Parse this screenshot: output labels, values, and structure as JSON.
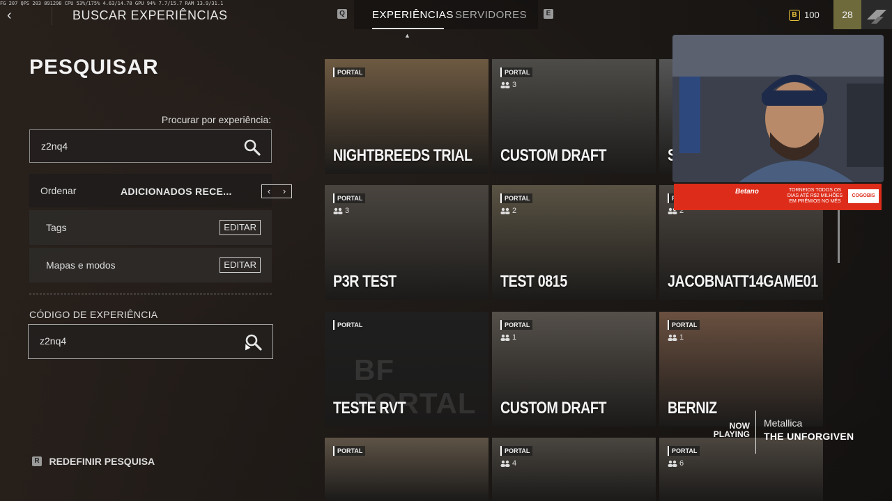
{
  "overlay": {
    "perf_stats": "FG 207 QPS 203 891298 CPU 53%/175% 4.63/14.78 GPU 94% 7.7/15.7 RAM 13.9/31.1"
  },
  "header": {
    "page_title": "BUSCAR EXPERIÊNCIAS",
    "key_left": "Q",
    "key_right": "E",
    "tabs": [
      {
        "label": "EXPERIÊNCIAS",
        "active": true
      },
      {
        "label": "SERVIDORES",
        "active": false
      }
    ],
    "currency": {
      "value": "100",
      "icon": "b-coin-icon"
    },
    "level": "28"
  },
  "left_panel": {
    "heading": "PESQUISAR",
    "search_label": "Procurar por experiência:",
    "search_value": "z2nq4",
    "sort": {
      "label": "Ordenar",
      "value": "ADICIONADOS RECE..."
    },
    "tags": {
      "label": "Tags",
      "button": "EDITAR"
    },
    "maps": {
      "label": "Mapas e modos",
      "button": "EDITAR"
    },
    "code_label": "CÓDIGO DE EXPERIÊNCIA",
    "code_value": "z2nq4",
    "reset": {
      "key": "R",
      "label": "REDEFINIR PESQUISA"
    }
  },
  "grid": {
    "cards": [
      {
        "badge": "PORTAL",
        "players": "",
        "title": "NIGHTBREEDS TRIAL",
        "bg": "#6e5a42"
      },
      {
        "badge": "PORTAL",
        "players": "3",
        "title": "CUSTOM DRAFT",
        "bg": "#4e4c48"
      },
      {
        "badge": "PORTAL",
        "players": "",
        "title": "S",
        "bg": "#555"
      },
      {
        "badge": "PORTAL",
        "players": "3",
        "title": "P3R TEST",
        "bg": "#4a453f"
      },
      {
        "badge": "PORTAL",
        "players": "2",
        "title": "TEST 0815",
        "bg": "#5a5344"
      },
      {
        "badge": "PORTAL",
        "players": "2",
        "title": "JACOBNATT14GAME01",
        "bg": "#4c4640"
      },
      {
        "badge": "PORTAL",
        "players": "",
        "title": "TESTE RVT",
        "bg": "#1f1f1f"
      },
      {
        "badge": "PORTAL",
        "players": "1",
        "title": "CUSTOM DRAFT",
        "bg": "#55504a"
      },
      {
        "badge": "PORTAL",
        "players": "1",
        "title": "BERNIZ",
        "bg": "#6a5040"
      },
      {
        "badge": "PORTAL",
        "players": "",
        "title": "",
        "bg": "#5e5346"
      },
      {
        "badge": "PORTAL",
        "players": "4",
        "title": "",
        "bg": "#4a4640"
      },
      {
        "badge": "PORTAL",
        "players": "6",
        "title": "",
        "bg": "#4c463f"
      }
    ],
    "watermark": "BF PORTAL"
  },
  "stream": {
    "banner_brand": "Betano",
    "banner_text": "TORNEIOS TODOS OS DIAS ATÉ R$2 MILHÕES EM PRÊMIOS NO MÊS",
    "banner_cta": "COGOBIS",
    "now_playing_label": "NOW PLAYING",
    "artist": "Metallica",
    "song": "THE UNFORGIVEN"
  },
  "colors": {
    "accent_gold": "#e6c03a",
    "level_bg": "#6e6a3c",
    "banner_red": "#dd2d1a"
  }
}
